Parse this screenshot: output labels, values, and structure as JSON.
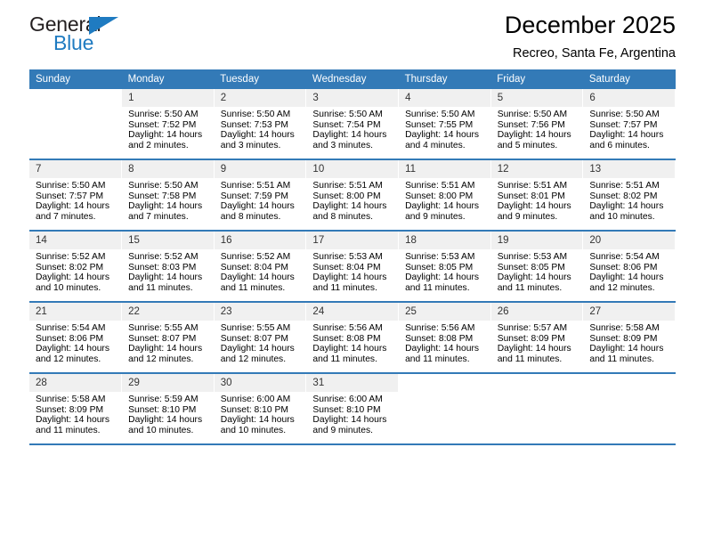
{
  "brand": {
    "line1": "General",
    "line2": "Blue",
    "triangle_icon": "triangle-icon",
    "color_dark": "#231f20",
    "color_blue": "#1f7bc1"
  },
  "header": {
    "month_title": "December 2025",
    "location": "Recreo, Santa Fe, Argentina"
  },
  "theme": {
    "header_bg": "#337ab7",
    "header_text": "#ffffff",
    "daynum_bg": "#f0f0f0",
    "cell_bg": "#ffffff"
  },
  "calendar": {
    "weekday_headers": [
      "Sunday",
      "Monday",
      "Tuesday",
      "Wednesday",
      "Thursday",
      "Friday",
      "Saturday"
    ],
    "weeks": [
      [
        {
          "day": "",
          "sunrise": "",
          "sunset": "",
          "daylight_line1": "",
          "daylight_line2": ""
        },
        {
          "day": "1",
          "sunrise": "Sunrise: 5:50 AM",
          "sunset": "Sunset: 7:52 PM",
          "daylight_line1": "Daylight: 14 hours",
          "daylight_line2": "and 2 minutes."
        },
        {
          "day": "2",
          "sunrise": "Sunrise: 5:50 AM",
          "sunset": "Sunset: 7:53 PM",
          "daylight_line1": "Daylight: 14 hours",
          "daylight_line2": "and 3 minutes."
        },
        {
          "day": "3",
          "sunrise": "Sunrise: 5:50 AM",
          "sunset": "Sunset: 7:54 PM",
          "daylight_line1": "Daylight: 14 hours",
          "daylight_line2": "and 3 minutes."
        },
        {
          "day": "4",
          "sunrise": "Sunrise: 5:50 AM",
          "sunset": "Sunset: 7:55 PM",
          "daylight_line1": "Daylight: 14 hours",
          "daylight_line2": "and 4 minutes."
        },
        {
          "day": "5",
          "sunrise": "Sunrise: 5:50 AM",
          "sunset": "Sunset: 7:56 PM",
          "daylight_line1": "Daylight: 14 hours",
          "daylight_line2": "and 5 minutes."
        },
        {
          "day": "6",
          "sunrise": "Sunrise: 5:50 AM",
          "sunset": "Sunset: 7:57 PM",
          "daylight_line1": "Daylight: 14 hours",
          "daylight_line2": "and 6 minutes."
        }
      ],
      [
        {
          "day": "7",
          "sunrise": "Sunrise: 5:50 AM",
          "sunset": "Sunset: 7:57 PM",
          "daylight_line1": "Daylight: 14 hours",
          "daylight_line2": "and 7 minutes."
        },
        {
          "day": "8",
          "sunrise": "Sunrise: 5:50 AM",
          "sunset": "Sunset: 7:58 PM",
          "daylight_line1": "Daylight: 14 hours",
          "daylight_line2": "and 7 minutes."
        },
        {
          "day": "9",
          "sunrise": "Sunrise: 5:51 AM",
          "sunset": "Sunset: 7:59 PM",
          "daylight_line1": "Daylight: 14 hours",
          "daylight_line2": "and 8 minutes."
        },
        {
          "day": "10",
          "sunrise": "Sunrise: 5:51 AM",
          "sunset": "Sunset: 8:00 PM",
          "daylight_line1": "Daylight: 14 hours",
          "daylight_line2": "and 8 minutes."
        },
        {
          "day": "11",
          "sunrise": "Sunrise: 5:51 AM",
          "sunset": "Sunset: 8:00 PM",
          "daylight_line1": "Daylight: 14 hours",
          "daylight_line2": "and 9 minutes."
        },
        {
          "day": "12",
          "sunrise": "Sunrise: 5:51 AM",
          "sunset": "Sunset: 8:01 PM",
          "daylight_line1": "Daylight: 14 hours",
          "daylight_line2": "and 9 minutes."
        },
        {
          "day": "13",
          "sunrise": "Sunrise: 5:51 AM",
          "sunset": "Sunset: 8:02 PM",
          "daylight_line1": "Daylight: 14 hours",
          "daylight_line2": "and 10 minutes."
        }
      ],
      [
        {
          "day": "14",
          "sunrise": "Sunrise: 5:52 AM",
          "sunset": "Sunset: 8:02 PM",
          "daylight_line1": "Daylight: 14 hours",
          "daylight_line2": "and 10 minutes."
        },
        {
          "day": "15",
          "sunrise": "Sunrise: 5:52 AM",
          "sunset": "Sunset: 8:03 PM",
          "daylight_line1": "Daylight: 14 hours",
          "daylight_line2": "and 11 minutes."
        },
        {
          "day": "16",
          "sunrise": "Sunrise: 5:52 AM",
          "sunset": "Sunset: 8:04 PM",
          "daylight_line1": "Daylight: 14 hours",
          "daylight_line2": "and 11 minutes."
        },
        {
          "day": "17",
          "sunrise": "Sunrise: 5:53 AM",
          "sunset": "Sunset: 8:04 PM",
          "daylight_line1": "Daylight: 14 hours",
          "daylight_line2": "and 11 minutes."
        },
        {
          "day": "18",
          "sunrise": "Sunrise: 5:53 AM",
          "sunset": "Sunset: 8:05 PM",
          "daylight_line1": "Daylight: 14 hours",
          "daylight_line2": "and 11 minutes."
        },
        {
          "day": "19",
          "sunrise": "Sunrise: 5:53 AM",
          "sunset": "Sunset: 8:05 PM",
          "daylight_line1": "Daylight: 14 hours",
          "daylight_line2": "and 11 minutes."
        },
        {
          "day": "20",
          "sunrise": "Sunrise: 5:54 AM",
          "sunset": "Sunset: 8:06 PM",
          "daylight_line1": "Daylight: 14 hours",
          "daylight_line2": "and 12 minutes."
        }
      ],
      [
        {
          "day": "21",
          "sunrise": "Sunrise: 5:54 AM",
          "sunset": "Sunset: 8:06 PM",
          "daylight_line1": "Daylight: 14 hours",
          "daylight_line2": "and 12 minutes."
        },
        {
          "day": "22",
          "sunrise": "Sunrise: 5:55 AM",
          "sunset": "Sunset: 8:07 PM",
          "daylight_line1": "Daylight: 14 hours",
          "daylight_line2": "and 12 minutes."
        },
        {
          "day": "23",
          "sunrise": "Sunrise: 5:55 AM",
          "sunset": "Sunset: 8:07 PM",
          "daylight_line1": "Daylight: 14 hours",
          "daylight_line2": "and 12 minutes."
        },
        {
          "day": "24",
          "sunrise": "Sunrise: 5:56 AM",
          "sunset": "Sunset: 8:08 PM",
          "daylight_line1": "Daylight: 14 hours",
          "daylight_line2": "and 11 minutes."
        },
        {
          "day": "25",
          "sunrise": "Sunrise: 5:56 AM",
          "sunset": "Sunset: 8:08 PM",
          "daylight_line1": "Daylight: 14 hours",
          "daylight_line2": "and 11 minutes."
        },
        {
          "day": "26",
          "sunrise": "Sunrise: 5:57 AM",
          "sunset": "Sunset: 8:09 PM",
          "daylight_line1": "Daylight: 14 hours",
          "daylight_line2": "and 11 minutes."
        },
        {
          "day": "27",
          "sunrise": "Sunrise: 5:58 AM",
          "sunset": "Sunset: 8:09 PM",
          "daylight_line1": "Daylight: 14 hours",
          "daylight_line2": "and 11 minutes."
        }
      ],
      [
        {
          "day": "28",
          "sunrise": "Sunrise: 5:58 AM",
          "sunset": "Sunset: 8:09 PM",
          "daylight_line1": "Daylight: 14 hours",
          "daylight_line2": "and 11 minutes."
        },
        {
          "day": "29",
          "sunrise": "Sunrise: 5:59 AM",
          "sunset": "Sunset: 8:10 PM",
          "daylight_line1": "Daylight: 14 hours",
          "daylight_line2": "and 10 minutes."
        },
        {
          "day": "30",
          "sunrise": "Sunrise: 6:00 AM",
          "sunset": "Sunset: 8:10 PM",
          "daylight_line1": "Daylight: 14 hours",
          "daylight_line2": "and 10 minutes."
        },
        {
          "day": "31",
          "sunrise": "Sunrise: 6:00 AM",
          "sunset": "Sunset: 8:10 PM",
          "daylight_line1": "Daylight: 14 hours",
          "daylight_line2": "and 9 minutes."
        },
        {
          "day": "",
          "sunrise": "",
          "sunset": "",
          "daylight_line1": "",
          "daylight_line2": ""
        },
        {
          "day": "",
          "sunrise": "",
          "sunset": "",
          "daylight_line1": "",
          "daylight_line2": ""
        },
        {
          "day": "",
          "sunrise": "",
          "sunset": "",
          "daylight_line1": "",
          "daylight_line2": ""
        }
      ]
    ]
  }
}
